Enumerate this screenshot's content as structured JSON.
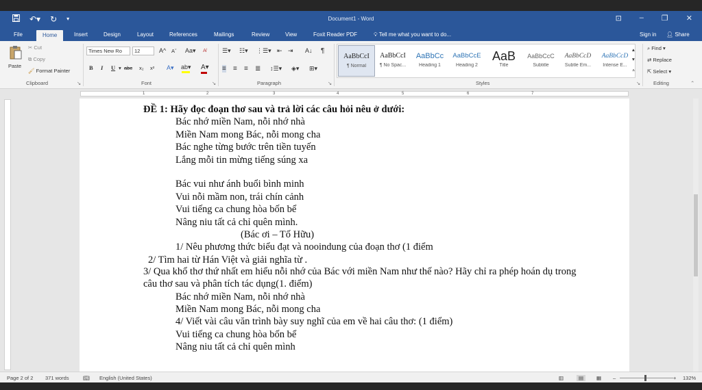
{
  "window": {
    "title": "Document1 - Word",
    "quick_access": [
      "save-icon",
      "undo-icon",
      "redo-icon",
      "customize-icon"
    ]
  },
  "tabs": [
    "File",
    "Home",
    "Insert",
    "Design",
    "Layout",
    "References",
    "Mailings",
    "Review",
    "View",
    "Foxit Reader PDF"
  ],
  "active_tab": "Home",
  "tell_me": "Tell me what you want to do...",
  "account": {
    "sign_in": "Sign in",
    "share": "Share"
  },
  "ribbon": {
    "clipboard": {
      "label": "Clipboard",
      "paste": "Paste",
      "cut": "Cut",
      "copy": "Copy",
      "format_painter": "Format Painter"
    },
    "font": {
      "label": "Font",
      "name": "Times New Ro",
      "size": "12",
      "grow": "A",
      "shrink": "A",
      "case": "Aa",
      "bold": "B",
      "italic": "I",
      "underline": "U",
      "strike": "abc",
      "subscript": "x₂",
      "superscript": "x²",
      "highlight_color": "#ffff00",
      "font_color": "#c00000"
    },
    "paragraph": {
      "label": "Paragraph"
    },
    "styles": {
      "label": "Styles",
      "items": [
        {
          "sample": "AaBbCcI",
          "name": "¶ Normal",
          "selected": true
        },
        {
          "sample": "AaBbCcI",
          "name": "¶ No Spac..."
        },
        {
          "sample": "AaBbCc",
          "name": "Heading 1"
        },
        {
          "sample": "AaBbCcE",
          "name": "Heading 2"
        },
        {
          "sample": "AaB",
          "name": "Title"
        },
        {
          "sample": "AaBbCcC",
          "name": "Subtitle"
        },
        {
          "sample": "AaBbCcD",
          "name": "Subtle Em..."
        },
        {
          "sample": "AaBbCcD",
          "name": "Intense E..."
        }
      ]
    },
    "editing": {
      "label": "Editing",
      "find": "Find",
      "replace": "Replace",
      "select": "Select"
    }
  },
  "ruler_numbers": [
    "1",
    "2",
    "3",
    "4",
    "5",
    "6",
    "7"
  ],
  "document": {
    "lines": [
      "ĐỀ 1:  Hãy đọc đoạn thơ sau và trả lời các câu hỏi nêu ở dưới:",
      "Bác nhớ miền Nam, nỗi nhớ nhà",
      "Miền Nam mong Bác, nỗi mong cha",
      "Bác nghe từng bước trên tiền tuyến",
      "Lắng mỗi tin mừng tiếng súng xa",
      "Bác vui như ánh buổi bình minh",
      "Vui nỗi mầm non, trái chín cảnh",
      "Vui tiếng ca chung hòa bốn bể",
      "Nâng niu tất cả chỉ quên mình.",
      "(Bác ơi – Tố Hữu)",
      "1/ Nêu phương thức biểu đạt và nooindung của đoạn thơ (1 điểm",
      "2/ Tìm hai từ  Hán Việt và giải nghĩa từ .",
      "3/ Qua khổ thơ thứ nhất em hiểu nỗi nhớ của Bác với miền Nam như thế nào? Hãy chỉ ra phép hoán dụ trong",
      "câu thơ sau và phân tích tác dụng(1. điểm)",
      "Bác nhớ miền Nam, nỗi nhớ nhà",
      "Miền Nam mong Bác, nỗi mong cha",
      "4/ Viết vài câu văn trình bày suy nghĩ của em về hai câu thơ: (1 điểm)",
      "Vui tiếng ca chung hòa bốn bể",
      "Nâng niu tất cả chỉ quên mình"
    ]
  },
  "status": {
    "page": "Page 2 of 2",
    "words": "371 words",
    "language": "English (United States)",
    "zoom": "132%"
  }
}
